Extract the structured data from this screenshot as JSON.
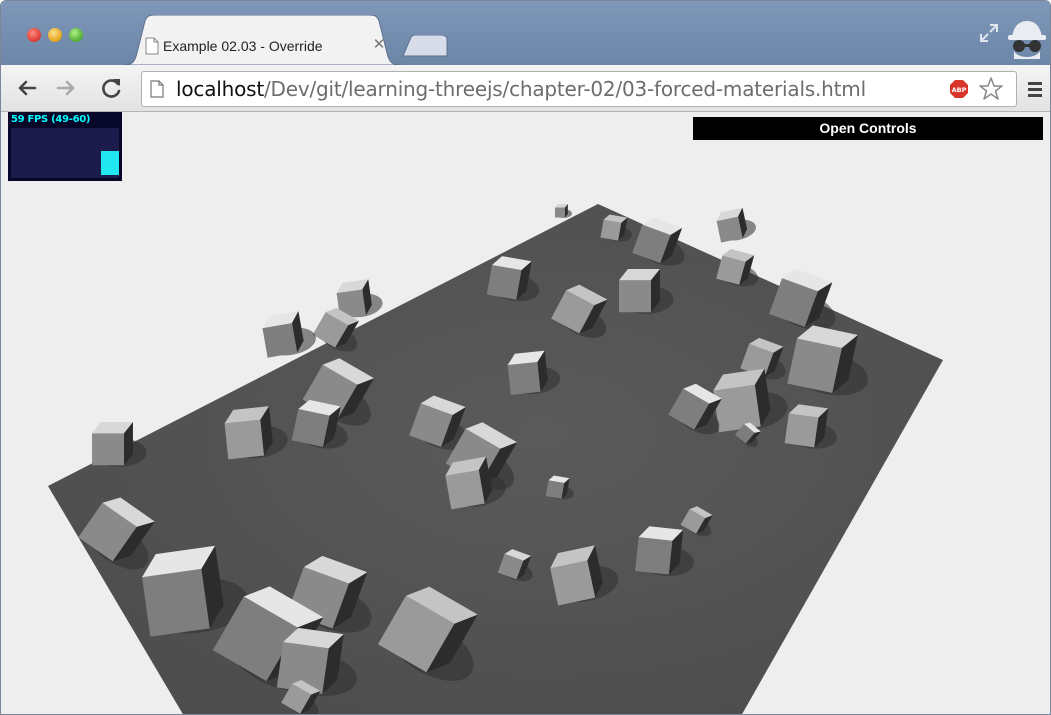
{
  "browser": {
    "tab": {
      "title": "Example 02.03 - Override"
    },
    "address": {
      "host": "localhost",
      "path": "/Dev/git/learning-threejs/chapter-02/03-forced-materials.html"
    }
  },
  "page": {
    "stats": {
      "fps_label": "59 FPS (49-60)",
      "fps_level": 0.55
    },
    "controls": {
      "label": "Open Controls"
    }
  },
  "colors": {
    "tabstrip": "#7a93b5",
    "plane": "#555555",
    "background": "#eeeeee",
    "stats_text": "#00ffff",
    "controls_bg": "#000000"
  }
}
